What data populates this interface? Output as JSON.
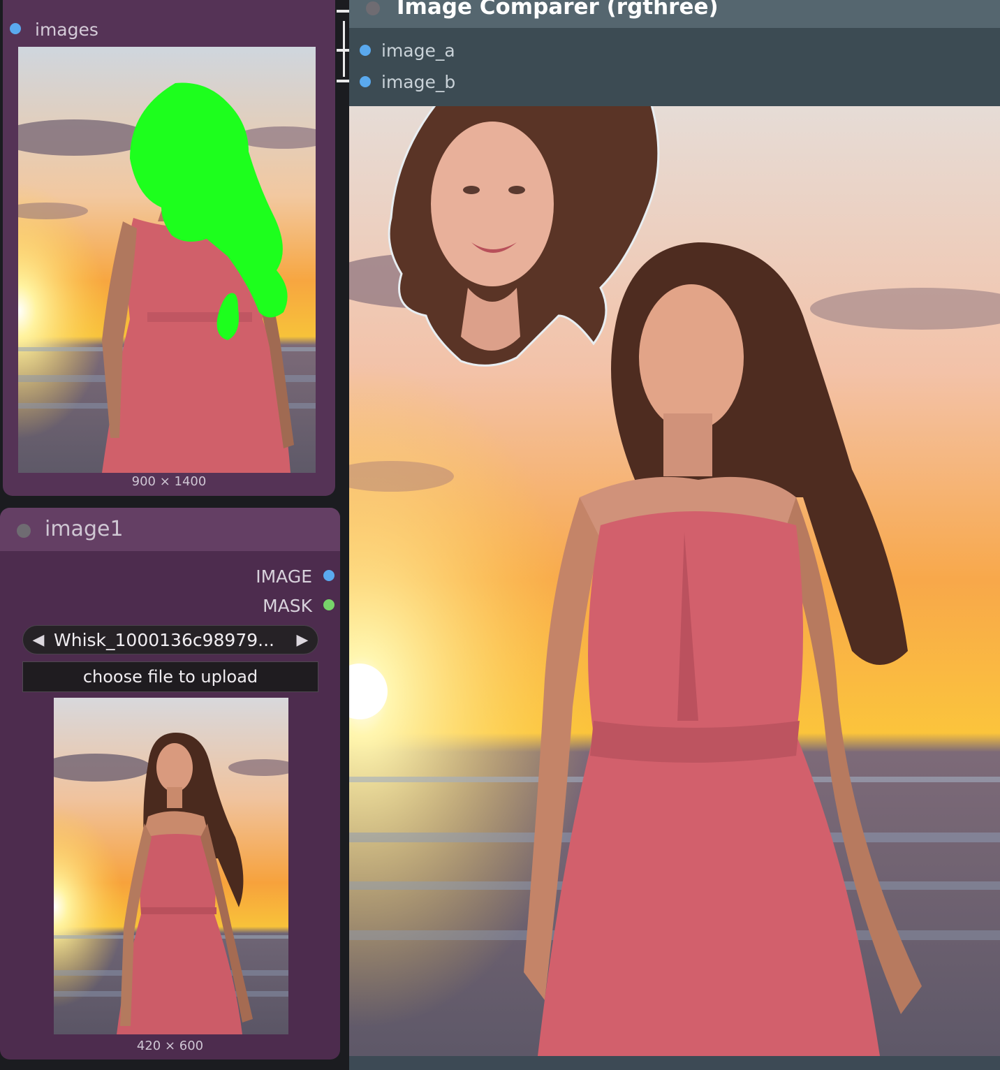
{
  "preview_node": {
    "input_label": "images",
    "dimensions": "900 × 1400"
  },
  "load_image_node": {
    "title": "image1",
    "outputs": [
      "IMAGE",
      "MASK"
    ],
    "filename": "Whisk_1000136c98979...",
    "upload_button": "choose file to upload",
    "dimensions": "420 × 600"
  },
  "comparer_node": {
    "title": "Image Comparer (rgthree)",
    "inputs": [
      "image_a",
      "image_b"
    ]
  },
  "colors": {
    "slot_image": "#5aa9ee",
    "slot_mask": "#77d46a",
    "mask_overlay": "#1dff1d",
    "node_purple": "#553356",
    "node_slate": "#3d4a55"
  },
  "icons": {
    "prev": "triangle-left-icon",
    "next": "triangle-right-icon"
  }
}
